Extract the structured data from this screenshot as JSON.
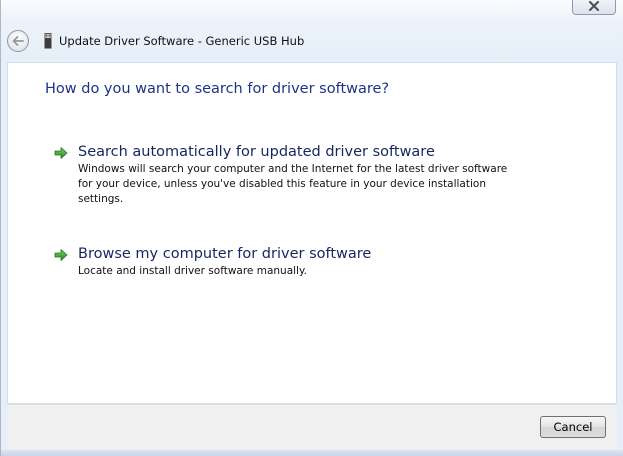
{
  "window": {
    "title": "Update Driver Software - Generic USB Hub",
    "close_label": "Close"
  },
  "icons": {
    "back": "back-arrow-icon",
    "device": "usb-device-icon",
    "option_arrow": "green-arrow-icon",
    "close": "close-x-icon"
  },
  "colors": {
    "heading": "#1e3287",
    "option_title": "#17265f",
    "option_arrow": "#2f9a2a"
  },
  "content": {
    "heading": "How do you want to search for driver software?",
    "options": [
      {
        "title": "Search automatically for updated driver software",
        "description": "Windows will search your computer and the Internet for the latest driver software for your device, unless you've disabled this feature in your device installation settings."
      },
      {
        "title": "Browse my computer for driver software",
        "description": "Locate and install driver software manually."
      }
    ]
  },
  "footer": {
    "cancel_label": "Cancel"
  }
}
